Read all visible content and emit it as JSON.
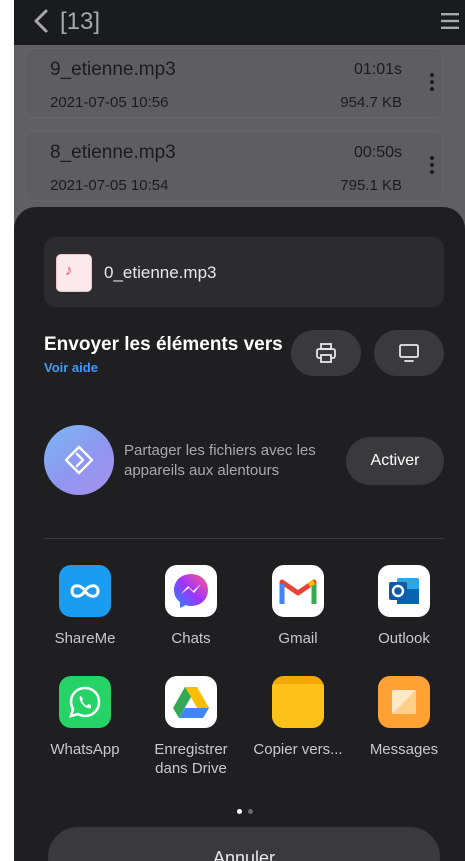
{
  "topbar": {
    "count": "[13]"
  },
  "files": [
    {
      "name": "9_etienne.mp3",
      "date": "2021-07-05  10:56",
      "duration": "01:01s",
      "size": "954.7 KB"
    },
    {
      "name": "8_etienne.mp3",
      "date": "2021-07-05  10:54",
      "duration": "00:50s",
      "size": "795.1 KB"
    }
  ],
  "share": {
    "file_name": "0_etienne.mp3",
    "send_title": "Envoyer les éléments vers",
    "help_link": "Voir aide",
    "nearby_text": "Partager les fichiers avec les appareils aux alentours",
    "activate_label": "Activer",
    "apps": [
      {
        "label": "ShareMe",
        "icon": "shareme-icon"
      },
      {
        "label": "Chats",
        "icon": "messenger-icon"
      },
      {
        "label": "Gmail",
        "icon": "gmail-icon"
      },
      {
        "label": "Outlook",
        "icon": "outlook-icon"
      },
      {
        "label": "WhatsApp",
        "icon": "whatsapp-icon"
      },
      {
        "label": "Enregistrer dans Drive",
        "icon": "google-drive-icon"
      },
      {
        "label": "Copier vers...",
        "icon": "folder-icon"
      },
      {
        "label": "Messages",
        "icon": "messages-icon"
      }
    ],
    "page_indicator": {
      "pages": 2,
      "current": 1
    },
    "cancel_label": "Annuler"
  },
  "colors": {
    "accent_link": "#3d9bff",
    "sheet_bg": "#1f1f21",
    "active_dot": "#ffffff",
    "inactive_dot": "#6a6a6c"
  }
}
